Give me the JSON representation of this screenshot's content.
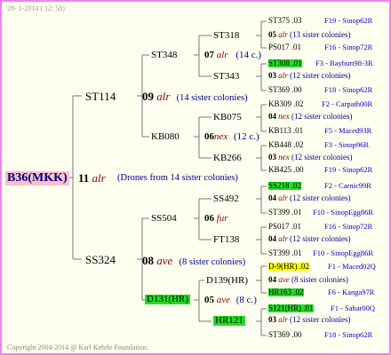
{
  "header": "28- 1-2014 ( 12: 58)",
  "footer": "Copyright 2004-2014 @ Karl Kehrle Foundation.",
  "root": {
    "label": "B36(MKK)",
    "num": "11",
    "sym": "alr",
    "note": "(Drones from 14 sister colonies)"
  },
  "gen2": [
    {
      "label": "ST114",
      "num": "09",
      "sym": "alr",
      "note": "(14 sister colonies)"
    },
    {
      "label": "SS324",
      "num": "08",
      "sym": "ave",
      "note": "(8 sister colonies)"
    }
  ],
  "gen3": [
    {
      "label": "ST348",
      "num": "07",
      "sym": "alr",
      "note": "(14 c.)"
    },
    {
      "label": "KB080",
      "num": "06",
      "sym": "nex",
      "note": "(12 c.)"
    },
    {
      "label": "SS504",
      "num": "06",
      "sym": "fur",
      "note": ""
    },
    {
      "label": "D131(HR)",
      "num": "05",
      "sym": "ave",
      "note": "(8 c.)"
    }
  ],
  "gen4": [
    {
      "label": "ST318",
      "num": "05",
      "sym": "alr",
      "note": "(13 sister colonies)"
    },
    {
      "label": "ST343",
      "num": "03",
      "sym": "alr",
      "note": "(12 sister colonies)"
    },
    {
      "label": "KB075",
      "num": "04",
      "sym": "nex",
      "note": "(12 sister colonies)"
    },
    {
      "label": "KB266",
      "num": "03",
      "sym": "nex",
      "note": "(12 sister colonies)"
    },
    {
      "label": "SS492",
      "num": "04",
      "sym": "alr",
      "note": "(12 sister colonies)"
    },
    {
      "label": "FT138",
      "num": "04",
      "sym": "alr",
      "note": "(12 sister colonies)"
    },
    {
      "label": "D139(HR)",
      "num": "04",
      "sym": "ave",
      "note": "(8 sister colonies)"
    },
    {
      "label": "HR121",
      "num": "03",
      "sym": "alr",
      "note": "(12 sister colonies)"
    }
  ],
  "gen5": [
    {
      "code": "ST375 .03",
      "loc": "F19 - Sinop62R"
    },
    {
      "code": "PS017 .01",
      "loc": "F16 - Sinop72R"
    },
    {
      "code": "ST308 .01",
      "loc": "F3 - Bayburt98-3R"
    },
    {
      "code": "ST369 .00",
      "loc": "F18 - Sinop62R"
    },
    {
      "code": "KB309 .02",
      "loc": "F2 - Carpath00R"
    },
    {
      "code": "KB113 .01",
      "loc": "F5 - Maced93R"
    },
    {
      "code": "KB448 .02",
      "loc": "F3 - Sinop96R"
    },
    {
      "code": "KB425 .00",
      "loc": "F19 - Sinop62R"
    },
    {
      "code": "SS218 .02",
      "loc": "F2 - Carnic99R"
    },
    {
      "code": "ST399 .01",
      "loc": "F10 - SinopEgg86R"
    },
    {
      "code": "PS017 .01",
      "loc": "F16 - Sinop72R"
    },
    {
      "code": "ST399 .01",
      "loc": "F10 - SinopEgg86R"
    },
    {
      "code": "D-9(HR) .02",
      "loc": "F1 - Maced02Q"
    },
    {
      "code": "HR163 .02",
      "loc": "F6 - Kanga97R"
    },
    {
      "code": "S121(HR) .01",
      "loc": "F1 - Sahar00Q"
    },
    {
      "code": "ST369 .00",
      "loc": "F18 - Sinop62R"
    }
  ]
}
